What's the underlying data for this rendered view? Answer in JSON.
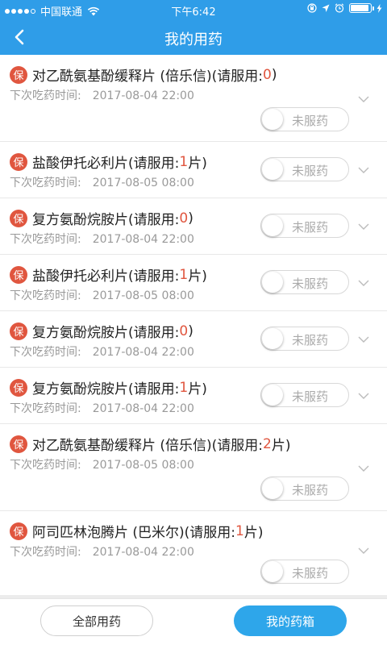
{
  "status_bar": {
    "carrier": "中国联通",
    "time": "下午6:42",
    "battery_level": 0.9
  },
  "nav": {
    "title": "我的用药",
    "back_icon": "chevron-left-icon"
  },
  "colors": {
    "primary": "#2f9de8",
    "dose_highlight": "#e0563f",
    "badge": "#e0563f",
    "active_button": "#2ea6ea"
  },
  "medications": [
    {
      "badge": "保",
      "name": "对乙酰氨基酚缓释片 (倍乐信)(请服用:",
      "dose": "0",
      "unit": " )",
      "time_label": "下次吃药时间:",
      "next_time": "2017-08-04 22:00",
      "status": "未服药"
    },
    {
      "badge": "保",
      "name": "盐酸伊托必利片(请服用:",
      "dose": "1",
      "unit": " 片)",
      "time_label": "下次吃药时间:",
      "next_time": "2017-08-05 08:00",
      "status": "未服药"
    },
    {
      "badge": "保",
      "name": "复方氨酚烷胺片(请服用:",
      "dose": "0",
      "unit": " )",
      "time_label": "下次吃药时间:",
      "next_time": "2017-08-04 22:00",
      "status": "未服药"
    },
    {
      "badge": "保",
      "name": "盐酸伊托必利片(请服用:",
      "dose": "1",
      "unit": " 片)",
      "time_label": "下次吃药时间:",
      "next_time": "2017-08-05 08:00",
      "status": "未服药"
    },
    {
      "badge": "保",
      "name": "复方氨酚烷胺片(请服用:",
      "dose": "0",
      "unit": " )",
      "time_label": "下次吃药时间:",
      "next_time": "2017-08-04 22:00",
      "status": "未服药"
    },
    {
      "badge": "保",
      "name": "复方氨酚烷胺片(请服用:",
      "dose": "1",
      "unit": " 片)",
      "time_label": "下次吃药时间:",
      "next_time": "2017-08-04 22:00",
      "status": "未服药"
    },
    {
      "badge": "保",
      "name": "对乙酰氨基酚缓释片 (倍乐信)(请服用:",
      "dose": "2",
      "unit": " 片)",
      "time_label": "下次吃药时间:",
      "next_time": "2017-08-05 08:00",
      "status": "未服药"
    },
    {
      "badge": "保",
      "name": "阿司匹林泡腾片 (巴米尔)(请服用:",
      "dose": "1",
      "unit": " 片)",
      "time_label": "下次吃药时间:",
      "next_time": "2017-08-04 22:00",
      "status": "未服药"
    }
  ],
  "bottom_bar": {
    "all_meds_label": "全部用药",
    "my_box_label": "我的药箱"
  }
}
